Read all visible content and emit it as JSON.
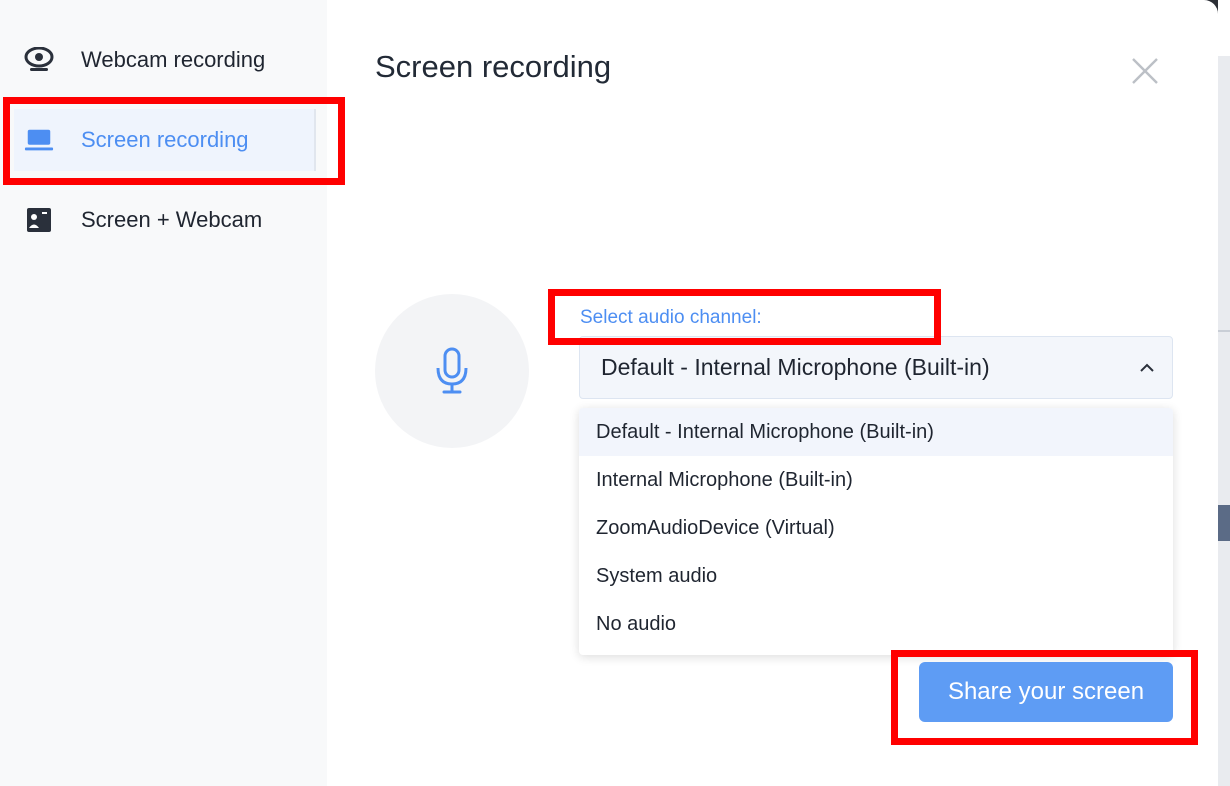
{
  "sidebar": {
    "items": [
      {
        "label": "Webcam recording",
        "icon": "webcam-icon",
        "active": false
      },
      {
        "label": "Screen recording",
        "icon": "laptop-icon",
        "active": true
      },
      {
        "label": "Screen + Webcam",
        "icon": "screen-webcam-icon",
        "active": false
      }
    ]
  },
  "main": {
    "title": "Screen recording",
    "close_icon": "close-icon",
    "mic_icon": "microphone-icon",
    "audio_label": "Select audio channel:",
    "selected_value": "Default - Internal Microphone (Built-in)",
    "options": [
      "Default - Internal Microphone (Built-in)",
      "Internal Microphone (Built-in)",
      "ZoomAudioDevice (Virtual)",
      "System audio",
      "No audio"
    ],
    "share_button": "Share your screen"
  },
  "colors": {
    "accent": "#4d8ef2",
    "button": "#5e9cf4",
    "highlight": "#ff0000",
    "text": "#1f2530"
  }
}
